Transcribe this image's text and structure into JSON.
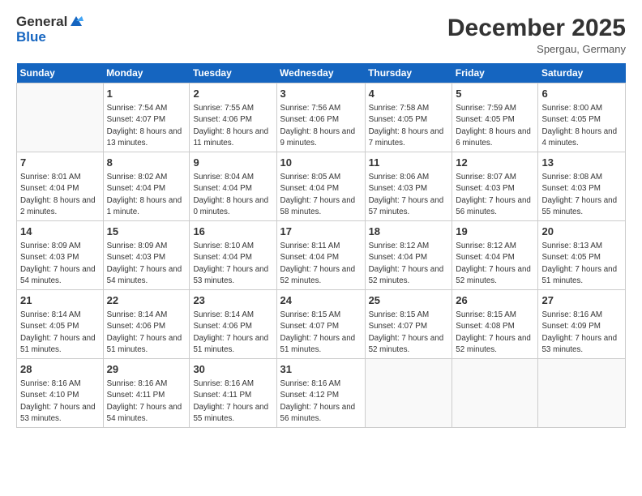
{
  "header": {
    "logo_general": "General",
    "logo_blue": "Blue",
    "month_title": "December 2025",
    "location": "Spergau, Germany"
  },
  "weekdays": [
    "Sunday",
    "Monday",
    "Tuesday",
    "Wednesday",
    "Thursday",
    "Friday",
    "Saturday"
  ],
  "weeks": [
    [
      {
        "day": "",
        "empty": true
      },
      {
        "day": "1",
        "sunrise": "Sunrise: 7:54 AM",
        "sunset": "Sunset: 4:07 PM",
        "daylight": "Daylight: 8 hours and 13 minutes."
      },
      {
        "day": "2",
        "sunrise": "Sunrise: 7:55 AM",
        "sunset": "Sunset: 4:06 PM",
        "daylight": "Daylight: 8 hours and 11 minutes."
      },
      {
        "day": "3",
        "sunrise": "Sunrise: 7:56 AM",
        "sunset": "Sunset: 4:06 PM",
        "daylight": "Daylight: 8 hours and 9 minutes."
      },
      {
        "day": "4",
        "sunrise": "Sunrise: 7:58 AM",
        "sunset": "Sunset: 4:05 PM",
        "daylight": "Daylight: 8 hours and 7 minutes."
      },
      {
        "day": "5",
        "sunrise": "Sunrise: 7:59 AM",
        "sunset": "Sunset: 4:05 PM",
        "daylight": "Daylight: 8 hours and 6 minutes."
      },
      {
        "day": "6",
        "sunrise": "Sunrise: 8:00 AM",
        "sunset": "Sunset: 4:05 PM",
        "daylight": "Daylight: 8 hours and 4 minutes."
      }
    ],
    [
      {
        "day": "7",
        "sunrise": "Sunrise: 8:01 AM",
        "sunset": "Sunset: 4:04 PM",
        "daylight": "Daylight: 8 hours and 2 minutes."
      },
      {
        "day": "8",
        "sunrise": "Sunrise: 8:02 AM",
        "sunset": "Sunset: 4:04 PM",
        "daylight": "Daylight: 8 hours and 1 minute."
      },
      {
        "day": "9",
        "sunrise": "Sunrise: 8:04 AM",
        "sunset": "Sunset: 4:04 PM",
        "daylight": "Daylight: 8 hours and 0 minutes."
      },
      {
        "day": "10",
        "sunrise": "Sunrise: 8:05 AM",
        "sunset": "Sunset: 4:04 PM",
        "daylight": "Daylight: 7 hours and 58 minutes."
      },
      {
        "day": "11",
        "sunrise": "Sunrise: 8:06 AM",
        "sunset": "Sunset: 4:03 PM",
        "daylight": "Daylight: 7 hours and 57 minutes."
      },
      {
        "day": "12",
        "sunrise": "Sunrise: 8:07 AM",
        "sunset": "Sunset: 4:03 PM",
        "daylight": "Daylight: 7 hours and 56 minutes."
      },
      {
        "day": "13",
        "sunrise": "Sunrise: 8:08 AM",
        "sunset": "Sunset: 4:03 PM",
        "daylight": "Daylight: 7 hours and 55 minutes."
      }
    ],
    [
      {
        "day": "14",
        "sunrise": "Sunrise: 8:09 AM",
        "sunset": "Sunset: 4:03 PM",
        "daylight": "Daylight: 7 hours and 54 minutes."
      },
      {
        "day": "15",
        "sunrise": "Sunrise: 8:09 AM",
        "sunset": "Sunset: 4:03 PM",
        "daylight": "Daylight: 7 hours and 54 minutes."
      },
      {
        "day": "16",
        "sunrise": "Sunrise: 8:10 AM",
        "sunset": "Sunset: 4:04 PM",
        "daylight": "Daylight: 7 hours and 53 minutes."
      },
      {
        "day": "17",
        "sunrise": "Sunrise: 8:11 AM",
        "sunset": "Sunset: 4:04 PM",
        "daylight": "Daylight: 7 hours and 52 minutes."
      },
      {
        "day": "18",
        "sunrise": "Sunrise: 8:12 AM",
        "sunset": "Sunset: 4:04 PM",
        "daylight": "Daylight: 7 hours and 52 minutes."
      },
      {
        "day": "19",
        "sunrise": "Sunrise: 8:12 AM",
        "sunset": "Sunset: 4:04 PM",
        "daylight": "Daylight: 7 hours and 52 minutes."
      },
      {
        "day": "20",
        "sunrise": "Sunrise: 8:13 AM",
        "sunset": "Sunset: 4:05 PM",
        "daylight": "Daylight: 7 hours and 51 minutes."
      }
    ],
    [
      {
        "day": "21",
        "sunrise": "Sunrise: 8:14 AM",
        "sunset": "Sunset: 4:05 PM",
        "daylight": "Daylight: 7 hours and 51 minutes."
      },
      {
        "day": "22",
        "sunrise": "Sunrise: 8:14 AM",
        "sunset": "Sunset: 4:06 PM",
        "daylight": "Daylight: 7 hours and 51 minutes."
      },
      {
        "day": "23",
        "sunrise": "Sunrise: 8:14 AM",
        "sunset": "Sunset: 4:06 PM",
        "daylight": "Daylight: 7 hours and 51 minutes."
      },
      {
        "day": "24",
        "sunrise": "Sunrise: 8:15 AM",
        "sunset": "Sunset: 4:07 PM",
        "daylight": "Daylight: 7 hours and 51 minutes."
      },
      {
        "day": "25",
        "sunrise": "Sunrise: 8:15 AM",
        "sunset": "Sunset: 4:07 PM",
        "daylight": "Daylight: 7 hours and 52 minutes."
      },
      {
        "day": "26",
        "sunrise": "Sunrise: 8:15 AM",
        "sunset": "Sunset: 4:08 PM",
        "daylight": "Daylight: 7 hours and 52 minutes."
      },
      {
        "day": "27",
        "sunrise": "Sunrise: 8:16 AM",
        "sunset": "Sunset: 4:09 PM",
        "daylight": "Daylight: 7 hours and 53 minutes."
      }
    ],
    [
      {
        "day": "28",
        "sunrise": "Sunrise: 8:16 AM",
        "sunset": "Sunset: 4:10 PM",
        "daylight": "Daylight: 7 hours and 53 minutes."
      },
      {
        "day": "29",
        "sunrise": "Sunrise: 8:16 AM",
        "sunset": "Sunset: 4:11 PM",
        "daylight": "Daylight: 7 hours and 54 minutes."
      },
      {
        "day": "30",
        "sunrise": "Sunrise: 8:16 AM",
        "sunset": "Sunset: 4:11 PM",
        "daylight": "Daylight: 7 hours and 55 minutes."
      },
      {
        "day": "31",
        "sunrise": "Sunrise: 8:16 AM",
        "sunset": "Sunset: 4:12 PM",
        "daylight": "Daylight: 7 hours and 56 minutes."
      },
      {
        "day": "",
        "empty": true
      },
      {
        "day": "",
        "empty": true
      },
      {
        "day": "",
        "empty": true
      }
    ]
  ]
}
